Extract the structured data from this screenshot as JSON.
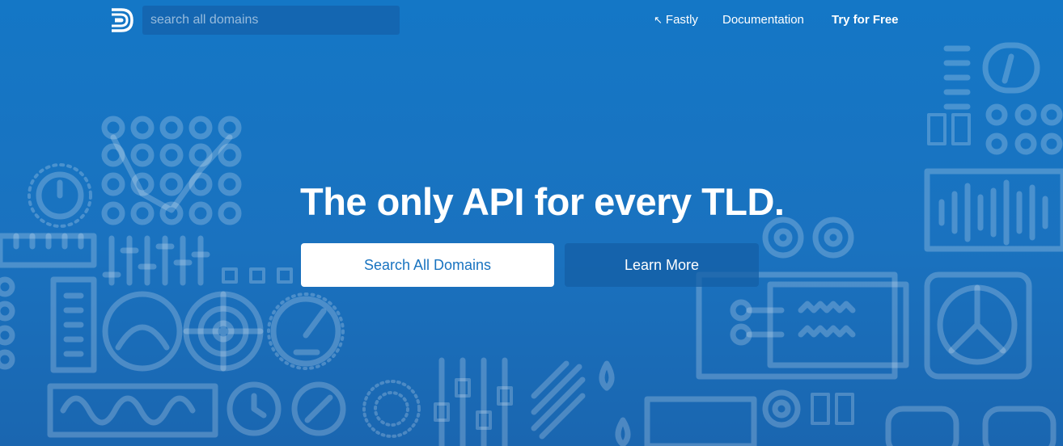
{
  "header": {
    "logo_icon": "domainr-logo-icon",
    "search_placeholder": "search all domains",
    "nav": {
      "fastly": "Fastly",
      "fastly_icon": "arrow-up-left-icon",
      "documentation": "Documentation",
      "try_free": "Try for Free"
    }
  },
  "hero": {
    "headline": "The only API for every TLD.",
    "primary_button": "Search All Domains",
    "secondary_button": "Learn More"
  },
  "colors": {
    "background": "#1477c6",
    "primary_button_bg": "#ffffff",
    "primary_button_text": "#1873c0",
    "secondary_button_bg": "#145fa5"
  }
}
